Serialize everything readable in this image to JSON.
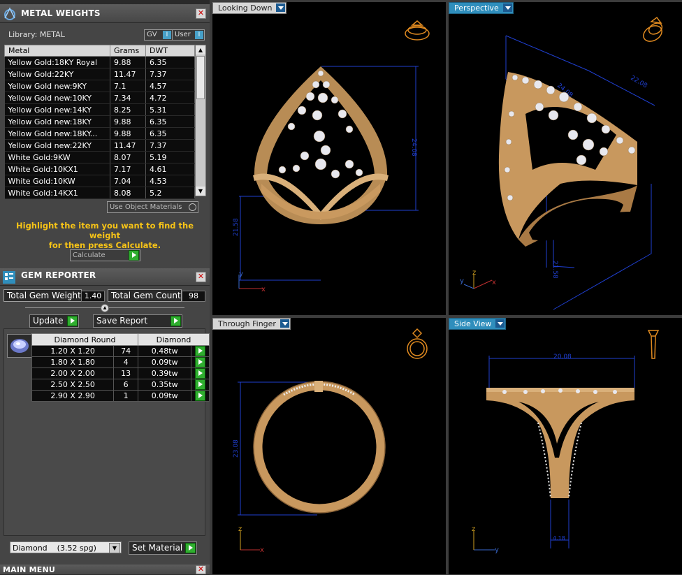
{
  "metal_weights": {
    "title": "METAL WEIGHTS",
    "library_label": "Library: METAL",
    "gv_label": "GV",
    "user_label": "User",
    "columns": [
      "Metal",
      "Grams",
      "DWT"
    ],
    "rows": [
      {
        "metal": "Yellow Gold:18KY Royal",
        "grams": "9.88",
        "dwt": "6.35"
      },
      {
        "metal": "Yellow Gold:22KY",
        "grams": "11.47",
        "dwt": "7.37"
      },
      {
        "metal": "Yellow Gold new:9KY",
        "grams": "7.1",
        "dwt": "4.57"
      },
      {
        "metal": "Yellow Gold new:10KY",
        "grams": "7.34",
        "dwt": "4.72"
      },
      {
        "metal": "Yellow Gold new:14KY",
        "grams": "8.25",
        "dwt": "5.31"
      },
      {
        "metal": "Yellow Gold new:18KY",
        "grams": "9.88",
        "dwt": "6.35"
      },
      {
        "metal": "Yellow Gold new:18KY...",
        "grams": "9.88",
        "dwt": "6.35"
      },
      {
        "metal": "Yellow Gold new:22KY",
        "grams": "11.47",
        "dwt": "7.37"
      },
      {
        "metal": "White Gold:9KW",
        "grams": "8.07",
        "dwt": "5.19"
      },
      {
        "metal": "White Gold:10KX1",
        "grams": "7.17",
        "dwt": "4.61"
      },
      {
        "metal": "White Gold:10KW",
        "grams": "7.04",
        "dwt": "4.53"
      },
      {
        "metal": "White Gold:14KX1",
        "grams": "8.08",
        "dwt": "5.2"
      }
    ],
    "use_object_materials": "Use Object Materials",
    "help_line1": "Highlight the item you want to find the weight",
    "help_line2": "for then press Calculate.",
    "calculate_label": "Calculate"
  },
  "gem_reporter": {
    "title": "GEM REPORTER",
    "total_weight_label": "Total Gem Weight",
    "total_weight_value": "1.40",
    "total_count_label": "Total Gem Count",
    "total_count_value": "98",
    "update_label": "Update",
    "save_report_label": "Save Report",
    "columns": [
      "Diamond Round",
      "Diamond"
    ],
    "rows": [
      {
        "size": "1.20 X 1.20",
        "count": "74",
        "weight": "0.48tw"
      },
      {
        "size": "1.80 X 1.80",
        "count": "4",
        "weight": "0.09tw"
      },
      {
        "size": "2.00 X 2.00",
        "count": "13",
        "weight": "0.39tw"
      },
      {
        "size": "2.50 X 2.50",
        "count": "6",
        "weight": "0.35tw"
      },
      {
        "size": "2.90 X 2.90",
        "count": "1",
        "weight": "0.09tw"
      }
    ],
    "material_select": "Diamond    (3.52 spg)",
    "set_material_label": "Set Material"
  },
  "main_menu": {
    "title": "MAIN MENU"
  },
  "viewports": {
    "top_left": {
      "label": "Looking Down",
      "dim_height": "24.08",
      "dim_width": "21.58",
      "axis_x": "x",
      "axis_y": "y"
    },
    "top_right": {
      "label": "Perspective",
      "dim_top": "22.08",
      "dim_side": "24.08",
      "dim_ring": "21.58",
      "axis_x": "x",
      "axis_y": "y",
      "axis_z": "z"
    },
    "bottom_left": {
      "label": "Through Finger",
      "dim_height": "23.08",
      "axis_x": "x",
      "axis_z": "z"
    },
    "bottom_right": {
      "label": "Side View",
      "dim_top": "20.08",
      "dim_bottom": "4.18",
      "axis_y": "y",
      "axis_z": "z"
    }
  },
  "colors": {
    "gold": "#d9b07a",
    "dim_line": "#1f3fd0",
    "accent_tab": "#2f8ebc",
    "help_text": "#f6c317"
  }
}
